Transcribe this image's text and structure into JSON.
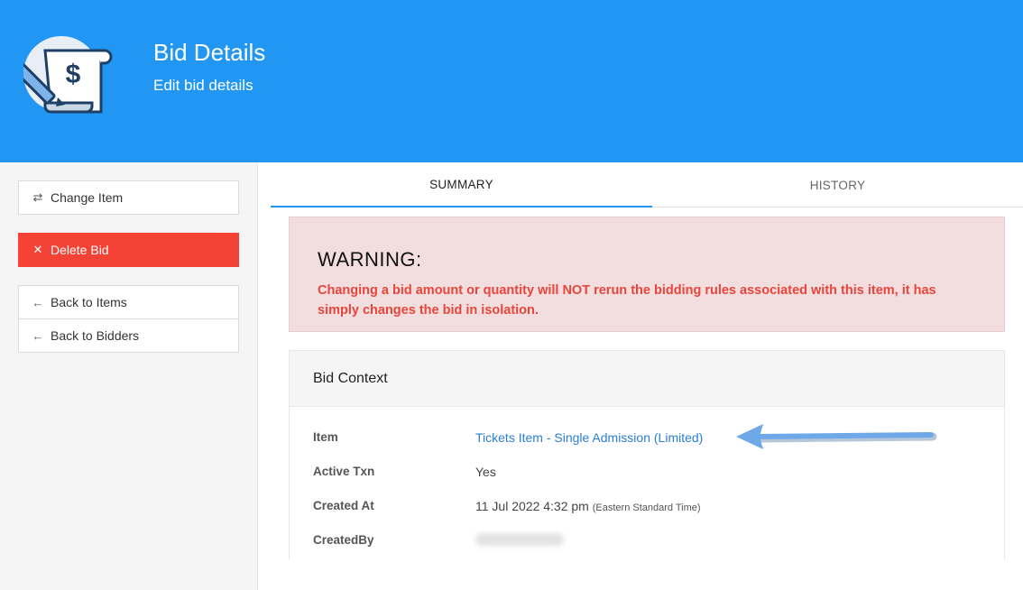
{
  "header": {
    "title": "Bid Details",
    "subtitle": "Edit bid details",
    "logo_icon": "bid-document-pencil-icon",
    "background_color": "#2196f3"
  },
  "sidebar": {
    "change_item": "Change Item",
    "delete_bid": "Delete Bid",
    "back_to_items": "Back to Items",
    "back_to_bidders": "Back to Bidders",
    "delete_color": "#f44336"
  },
  "tabs": [
    {
      "label": "SUMMARY",
      "active": true
    },
    {
      "label": "HISTORY",
      "active": false
    }
  ],
  "warning": {
    "title": "WARNING:",
    "text": "Changing a bid amount or quantity will NOT rerun the bidding rules associated with this item, it has simply changes the bid in isolation."
  },
  "bid_context": {
    "title": "Bid Context",
    "rows": [
      {
        "label": "Item",
        "value": "Tickets Item - Single Admission (Limited)"
      },
      {
        "label": "Active Txn",
        "value": "Yes"
      },
      {
        "label": "Created At",
        "value": "11 Jul 2022 4:32 pm",
        "note": "(Eastern Standard Time)"
      },
      {
        "label": "CreatedBy",
        "value": ""
      }
    ]
  }
}
